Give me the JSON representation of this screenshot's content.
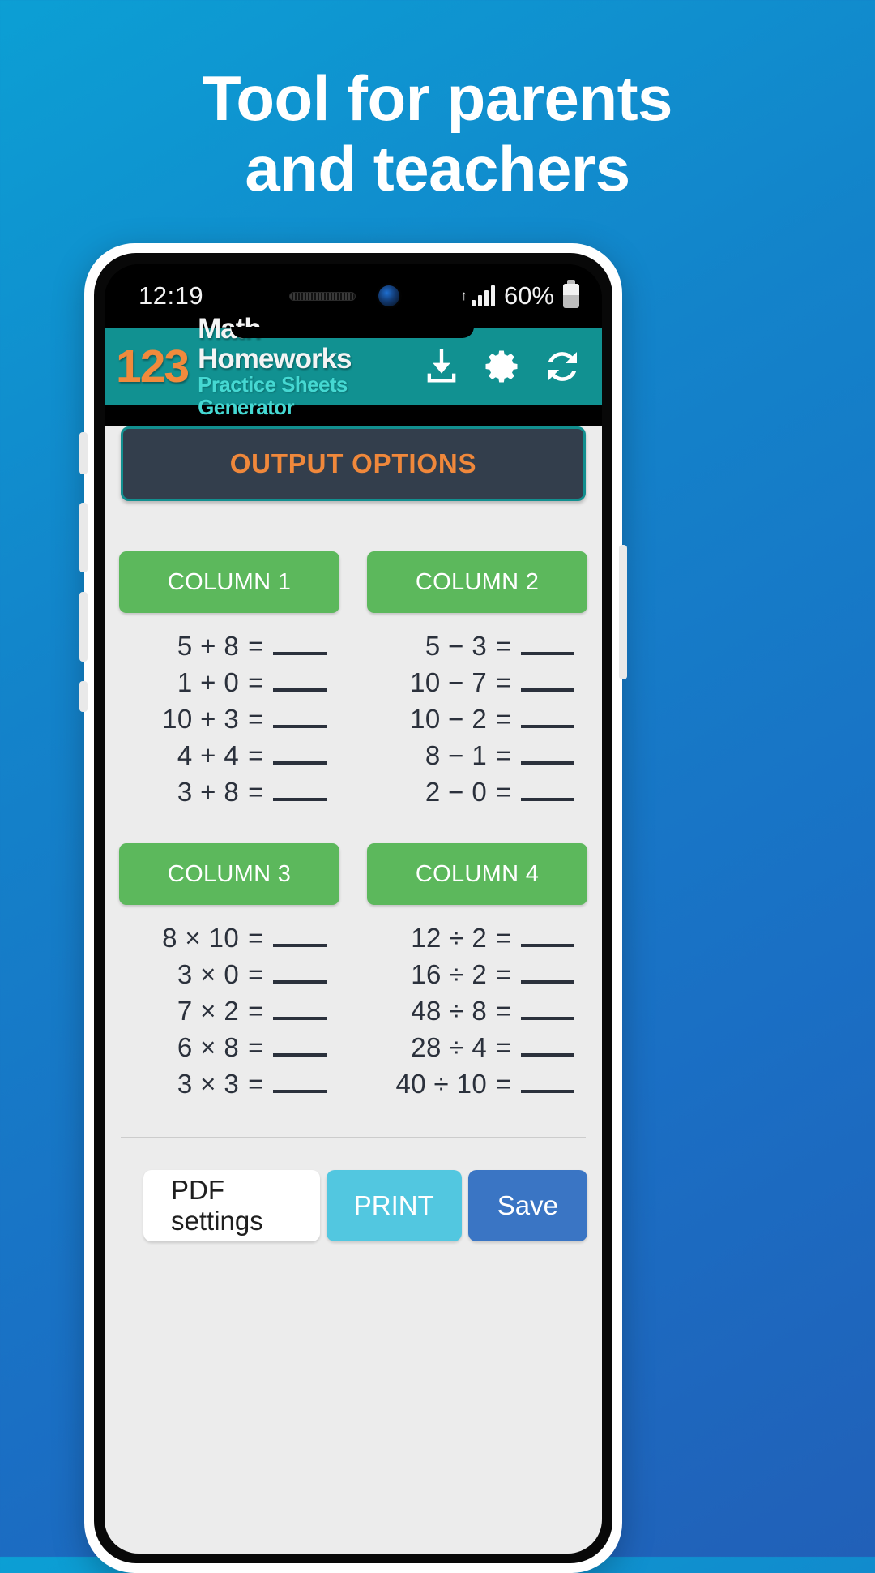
{
  "promo": {
    "headline_line1": "Tool for parents",
    "headline_line2": "and teachers"
  },
  "status_bar": {
    "time": "12:19",
    "battery_percent": "60%",
    "signal_icon": "signal-bars-icon",
    "battery_icon": "battery-icon"
  },
  "app_header": {
    "logo_number": "123",
    "title": "Math Homeworks",
    "subtitle": "Practice Sheets Generator",
    "actions": [
      {
        "name": "download-icon",
        "label": "Download"
      },
      {
        "name": "gear-icon",
        "label": "Settings"
      },
      {
        "name": "refresh-icon",
        "label": "Refresh"
      }
    ]
  },
  "main": {
    "output_options_label": "OUTPUT OPTIONS",
    "columns": [
      {
        "header": "COLUMN 1",
        "problems": [
          {
            "expr": "5 + 8",
            "eq": "=",
            "answer": ""
          },
          {
            "expr": "1 + 0",
            "eq": "=",
            "answer": ""
          },
          {
            "expr": "10 + 3",
            "eq": "=",
            "answer": ""
          },
          {
            "expr": "4 + 4",
            "eq": "=",
            "answer": ""
          },
          {
            "expr": "3 + 8",
            "eq": "=",
            "answer": ""
          }
        ]
      },
      {
        "header": "COLUMN 2",
        "problems": [
          {
            "expr": "5 − 3",
            "eq": "=",
            "answer": ""
          },
          {
            "expr": "10 − 7",
            "eq": "=",
            "answer": ""
          },
          {
            "expr": "10 − 2",
            "eq": "=",
            "answer": ""
          },
          {
            "expr": "8 − 1",
            "eq": "=",
            "answer": ""
          },
          {
            "expr": "2 − 0",
            "eq": "=",
            "answer": ""
          }
        ]
      },
      {
        "header": "COLUMN 3",
        "problems": [
          {
            "expr": "8 × 10",
            "eq": "=",
            "answer": ""
          },
          {
            "expr": "3 × 0",
            "eq": "=",
            "answer": ""
          },
          {
            "expr": "7 × 2",
            "eq": "=",
            "answer": ""
          },
          {
            "expr": "6 × 8",
            "eq": "=",
            "answer": ""
          },
          {
            "expr": "3 × 3",
            "eq": "=",
            "answer": ""
          }
        ]
      },
      {
        "header": "COLUMN 4",
        "problems": [
          {
            "expr": "12 ÷ 2",
            "eq": "=",
            "answer": ""
          },
          {
            "expr": "16 ÷ 2",
            "eq": "=",
            "answer": ""
          },
          {
            "expr": "48 ÷ 8",
            "eq": "=",
            "answer": ""
          },
          {
            "expr": "28 ÷ 4",
            "eq": "=",
            "answer": ""
          },
          {
            "expr": "40 ÷ 10",
            "eq": "=",
            "answer": ""
          }
        ]
      }
    ]
  },
  "bottom_actions": {
    "pdf_settings_label": "PDF settings",
    "print_label": "PRINT",
    "save_label": "Save"
  },
  "colors": {
    "background_gradient_start": "#0c9fd4",
    "background_gradient_end": "#2160b8",
    "header_teal": "#119191",
    "logo_orange": "#f08a3c",
    "subtitle_cyan": "#45d8d2",
    "output_options_bg": "#333e4c",
    "column_green": "#5cb85c",
    "print_blue": "#52c7e0",
    "save_blue": "#3a75c4"
  }
}
